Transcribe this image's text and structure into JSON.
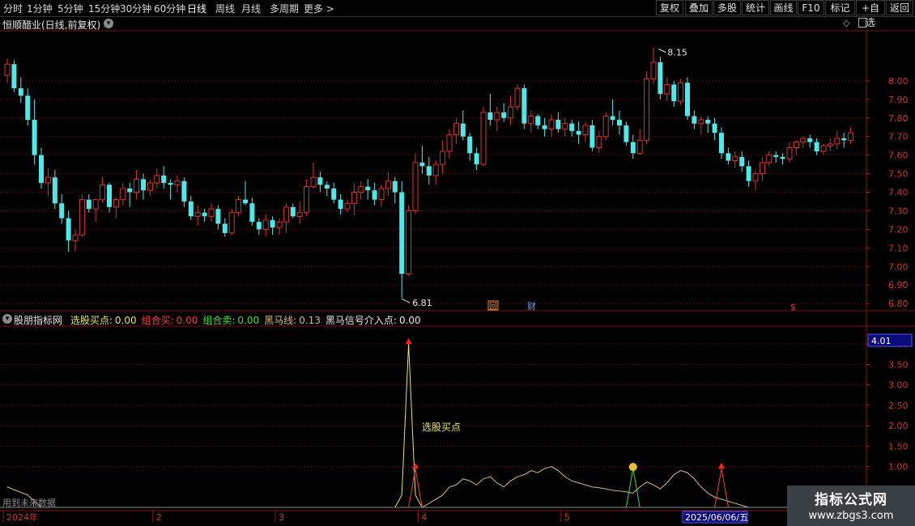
{
  "toolbar": {
    "timeframes": [
      "分时",
      "1分钟",
      "5分钟",
      "15分钟",
      "30分钟",
      "60分钟",
      "日线",
      "周线",
      "月线",
      "多周期",
      "更多 >"
    ],
    "active_index": 6,
    "right_buttons": [
      "复权",
      "叠加",
      "多股",
      "统计",
      "画线",
      "F10",
      "标记",
      "+自选",
      "返回"
    ]
  },
  "main_title": "恒顺醋业(日线,前复权)",
  "indicator": {
    "name": "股朋指标网",
    "items": [
      {
        "label": "选股买点:",
        "value": "0.00",
        "color": "#e8e84a"
      },
      {
        "label": "组合买:",
        "value": "0.00",
        "color": "#ff3b3b"
      },
      {
        "label": "组合卖:",
        "value": "0.00",
        "color": "#36e036"
      },
      {
        "label": "黑马线:",
        "value": "0.13",
        "color": "#d7b98a"
      },
      {
        "label": "黑马信号介入点:",
        "value": "0.00",
        "color": "#e8e8e8"
      }
    ],
    "annotation": "选股买点",
    "current_value": "4.01",
    "future_data_note": "用到未来数据"
  },
  "markers": {
    "high_label": "8.15",
    "low_label": "6.81",
    "badge_hui": "回",
    "badge_cai": "财",
    "badge_s": "$"
  },
  "date_axis": {
    "labels": [
      {
        "pos": 0,
        "text": "2024年"
      },
      {
        "pos": 22,
        "text": "2"
      },
      {
        "pos": 40,
        "text": "3"
      },
      {
        "pos": 61,
        "text": "4"
      },
      {
        "pos": 82,
        "text": "5"
      },
      {
        "pos": 101,
        "text": "6"
      }
    ],
    "cursor_date": "2025/06/06/五"
  },
  "chart_data": [
    {
      "type": "candlestick",
      "ylim": [
        6.77,
        8.27
      ],
      "yticks": [
        "8.00",
        "7.90",
        "7.80",
        "7.70",
        "7.60",
        "7.50",
        "7.40",
        "7.30",
        "7.20",
        "7.10",
        "7.00",
        "6.90",
        "6.80"
      ],
      "colors": {
        "up": "#e03030",
        "down": "#4ee8e8"
      },
      "ohlc": [
        [
          8.03,
          8.12,
          7.99,
          8.09
        ],
        [
          8.09,
          8.11,
          7.94,
          7.96
        ],
        [
          7.96,
          8.02,
          7.88,
          7.92
        ],
        [
          7.92,
          7.96,
          7.76,
          7.79
        ],
        [
          7.79,
          7.9,
          7.55,
          7.6
        ],
        [
          7.6,
          7.64,
          7.42,
          7.45
        ],
        [
          7.45,
          7.53,
          7.38,
          7.48
        ],
        [
          7.48,
          7.52,
          7.31,
          7.34
        ],
        [
          7.34,
          7.39,
          7.23,
          7.26
        ],
        [
          7.26,
          7.3,
          7.08,
          7.14
        ],
        [
          7.14,
          7.2,
          7.08,
          7.17
        ],
        [
          7.17,
          7.39,
          7.16,
          7.36
        ],
        [
          7.36,
          7.39,
          7.29,
          7.31
        ],
        [
          7.31,
          7.36,
          7.24,
          7.36
        ],
        [
          7.36,
          7.48,
          7.34,
          7.44
        ],
        [
          7.44,
          7.45,
          7.29,
          7.32
        ],
        [
          7.32,
          7.37,
          7.26,
          7.36
        ],
        [
          7.36,
          7.45,
          7.33,
          7.42
        ],
        [
          7.42,
          7.45,
          7.32,
          7.4
        ],
        [
          7.4,
          7.52,
          7.36,
          7.47
        ],
        [
          7.47,
          7.5,
          7.36,
          7.41
        ],
        [
          7.41,
          7.47,
          7.38,
          7.45
        ],
        [
          7.45,
          7.53,
          7.42,
          7.49
        ],
        [
          7.49,
          7.54,
          7.42,
          7.45
        ],
        [
          7.45,
          7.47,
          7.36,
          7.44
        ],
        [
          7.44,
          7.49,
          7.4,
          7.46
        ],
        [
          7.46,
          7.48,
          7.32,
          7.35
        ],
        [
          7.35,
          7.38,
          7.25,
          7.27
        ],
        [
          7.27,
          7.33,
          7.22,
          7.29
        ],
        [
          7.29,
          7.31,
          7.24,
          7.27
        ],
        [
          7.27,
          7.34,
          7.24,
          7.31
        ],
        [
          7.31,
          7.33,
          7.2,
          7.23
        ],
        [
          7.23,
          7.26,
          7.16,
          7.18
        ],
        [
          7.18,
          7.31,
          7.17,
          7.29
        ],
        [
          7.29,
          7.38,
          7.27,
          7.36
        ],
        [
          7.36,
          7.46,
          7.33,
          7.34
        ],
        [
          7.34,
          7.37,
          7.22,
          7.24
        ],
        [
          7.24,
          7.26,
          7.17,
          7.2
        ],
        [
          7.2,
          7.28,
          7.16,
          7.25
        ],
        [
          7.25,
          7.27,
          7.17,
          7.21
        ],
        [
          7.21,
          7.26,
          7.17,
          7.24
        ],
        [
          7.24,
          7.34,
          7.18,
          7.32
        ],
        [
          7.32,
          7.34,
          7.26,
          7.27
        ],
        [
          7.27,
          7.35,
          7.23,
          7.29
        ],
        [
          7.29,
          7.47,
          7.27,
          7.43
        ],
        [
          7.43,
          7.56,
          7.42,
          7.48
        ],
        [
          7.48,
          7.51,
          7.4,
          7.44
        ],
        [
          7.44,
          7.46,
          7.38,
          7.42
        ],
        [
          7.42,
          7.45,
          7.34,
          7.36
        ],
        [
          7.36,
          7.39,
          7.28,
          7.31
        ],
        [
          7.31,
          7.36,
          7.29,
          7.34
        ],
        [
          7.34,
          7.45,
          7.28,
          7.4
        ],
        [
          7.4,
          7.46,
          7.36,
          7.43
        ],
        [
          7.43,
          7.47,
          7.36,
          7.41
        ],
        [
          7.41,
          7.45,
          7.33,
          7.36
        ],
        [
          7.36,
          7.44,
          7.32,
          7.42
        ],
        [
          7.42,
          7.51,
          7.38,
          7.46
        ],
        [
          7.46,
          7.48,
          7.34,
          7.4
        ],
        [
          7.4,
          7.46,
          6.83,
          6.96
        ],
        [
          6.96,
          7.33,
          6.95,
          7.3
        ],
        [
          7.3,
          7.61,
          7.28,
          7.56
        ],
        [
          7.56,
          7.65,
          7.5,
          7.54
        ],
        [
          7.54,
          7.59,
          7.44,
          7.49
        ],
        [
          7.49,
          7.57,
          7.44,
          7.55
        ],
        [
          7.55,
          7.68,
          7.5,
          7.62
        ],
        [
          7.62,
          7.74,
          7.58,
          7.71
        ],
        [
          7.71,
          7.8,
          7.66,
          7.77
        ],
        [
          7.77,
          7.84,
          7.68,
          7.7
        ],
        [
          7.7,
          7.72,
          7.57,
          7.61
        ],
        [
          7.61,
          7.64,
          7.52,
          7.55
        ],
        [
          7.55,
          7.86,
          7.54,
          7.83
        ],
        [
          7.83,
          7.93,
          7.76,
          7.79
        ],
        [
          7.79,
          7.86,
          7.73,
          7.83
        ],
        [
          7.83,
          7.88,
          7.78,
          7.8
        ],
        [
          7.8,
          7.92,
          7.76,
          7.86
        ],
        [
          7.86,
          7.98,
          7.84,
          7.96
        ],
        [
          7.96,
          7.98,
          7.74,
          7.77
        ],
        [
          7.77,
          7.84,
          7.72,
          7.81
        ],
        [
          7.81,
          7.82,
          7.74,
          7.76
        ],
        [
          7.76,
          7.8,
          7.7,
          7.74
        ],
        [
          7.74,
          7.82,
          7.7,
          7.79
        ],
        [
          7.79,
          7.83,
          7.72,
          7.74
        ],
        [
          7.74,
          7.8,
          7.7,
          7.77
        ],
        [
          7.77,
          7.79,
          7.7,
          7.73
        ],
        [
          7.73,
          7.78,
          7.66,
          7.71
        ],
        [
          7.71,
          7.78,
          7.67,
          7.76
        ],
        [
          7.76,
          7.79,
          7.62,
          7.64
        ],
        [
          7.64,
          7.73,
          7.61,
          7.7
        ],
        [
          7.7,
          7.83,
          7.68,
          7.81
        ],
        [
          7.81,
          7.9,
          7.76,
          7.79
        ],
        [
          7.79,
          7.84,
          7.71,
          7.76
        ],
        [
          7.76,
          7.78,
          7.65,
          7.67
        ],
        [
          7.67,
          7.71,
          7.58,
          7.61
        ],
        [
          7.61,
          7.74,
          7.6,
          7.68
        ],
        [
          7.68,
          8.05,
          7.66,
          8.01
        ],
        [
          8.01,
          8.18,
          7.98,
          8.1
        ],
        [
          8.1,
          8.13,
          7.9,
          7.93
        ],
        [
          7.93,
          8.02,
          7.89,
          7.98
        ],
        [
          7.98,
          8.0,
          7.86,
          7.89
        ],
        [
          7.89,
          8.01,
          7.87,
          7.99
        ],
        [
          7.99,
          8.02,
          7.79,
          7.81
        ],
        [
          7.81,
          7.84,
          7.74,
          7.77
        ],
        [
          7.77,
          7.81,
          7.71,
          7.79
        ],
        [
          7.79,
          7.81,
          7.72,
          7.77
        ],
        [
          7.77,
          7.8,
          7.68,
          7.72
        ],
        [
          7.72,
          7.75,
          7.58,
          7.61
        ],
        [
          7.61,
          7.64,
          7.55,
          7.57
        ],
        [
          7.57,
          7.62,
          7.53,
          7.59
        ],
        [
          7.59,
          7.62,
          7.51,
          7.54
        ],
        [
          7.54,
          7.57,
          7.43,
          7.46
        ],
        [
          7.46,
          7.52,
          7.41,
          7.5
        ],
        [
          7.5,
          7.59,
          7.46,
          7.56
        ],
        [
          7.56,
          7.62,
          7.54,
          7.6
        ],
        [
          7.6,
          7.62,
          7.56,
          7.59
        ],
        [
          7.59,
          7.61,
          7.55,
          7.58
        ],
        [
          7.58,
          7.67,
          7.56,
          7.64
        ],
        [
          7.64,
          7.68,
          7.6,
          7.67
        ],
        [
          7.67,
          7.7,
          7.64,
          7.69
        ],
        [
          7.69,
          7.71,
          7.64,
          7.67
        ],
        [
          7.67,
          7.69,
          7.6,
          7.62
        ],
        [
          7.62,
          7.66,
          7.6,
          7.65
        ],
        [
          7.65,
          7.69,
          7.62,
          7.66
        ],
        [
          7.66,
          7.73,
          7.63,
          7.69
        ],
        [
          7.69,
          7.72,
          7.64,
          7.68
        ],
        [
          7.68,
          7.75,
          7.66,
          7.72
        ]
      ]
    },
    {
      "type": "line",
      "ylim": [
        0,
        4.3
      ],
      "yticks": [
        "4.00",
        "3.50",
        "3.00",
        "2.50",
        "2.00",
        "1.50",
        "1.00"
      ],
      "series": [
        {
          "name": "黑马线",
          "color": "#d7b98a",
          "x": [
            0,
            3,
            5,
            59,
            61,
            63,
            64,
            65,
            66,
            67,
            68,
            69,
            70,
            71,
            72,
            73,
            74,
            75,
            76,
            77,
            78,
            79,
            80,
            81,
            82,
            83,
            84,
            85,
            86,
            87,
            88,
            89,
            90,
            91,
            92,
            93,
            94,
            95,
            96,
            97,
            98,
            99,
            100,
            101,
            102,
            103,
            104,
            105,
            106,
            107,
            108,
            109,
            110
          ],
          "values": [
            0.5,
            0.3,
            0.0,
            0.0,
            0.0,
            0.2,
            0.3,
            0.5,
            0.55,
            0.7,
            0.65,
            0.55,
            0.7,
            0.75,
            0.6,
            0.5,
            0.65,
            0.75,
            0.8,
            0.9,
            0.85,
            0.95,
            1.0,
            0.9,
            0.75,
            0.65,
            0.6,
            0.55,
            0.5,
            0.48,
            0.45,
            0.42,
            0.4,
            0.38,
            0.35,
            0.5,
            0.62,
            0.55,
            0.45,
            0.6,
            0.8,
            0.9,
            0.85,
            0.7,
            0.5,
            0.35,
            0.25,
            0.2,
            0.15,
            0.1,
            0.05,
            0.0,
            0.0
          ]
        },
        {
          "name": "选股买点",
          "color": "#e8e84a",
          "x": [
            57,
            58,
            59,
            60,
            61
          ],
          "values": [
            0,
            0.3,
            4.0,
            0.3,
            0
          ]
        },
        {
          "name": "组合买",
          "color": "#ff3b3b",
          "x": [
            59,
            60,
            61
          ],
          "values": [
            0,
            0.95,
            0
          ]
        },
        {
          "name": "组合买",
          "color": "#ff3b3b",
          "x": [
            104,
            105,
            106
          ],
          "values": [
            0,
            0.95,
            0
          ]
        },
        {
          "name": "组合卖",
          "color": "#36e036",
          "x": [
            91,
            92,
            93
          ],
          "values": [
            0,
            0.95,
            0
          ]
        }
      ],
      "arrows": [
        {
          "x": 59,
          "y": 4.0
        },
        {
          "x": 60,
          "y": 0.95
        },
        {
          "x": 105,
          "y": 0.95
        }
      ]
    }
  ]
}
